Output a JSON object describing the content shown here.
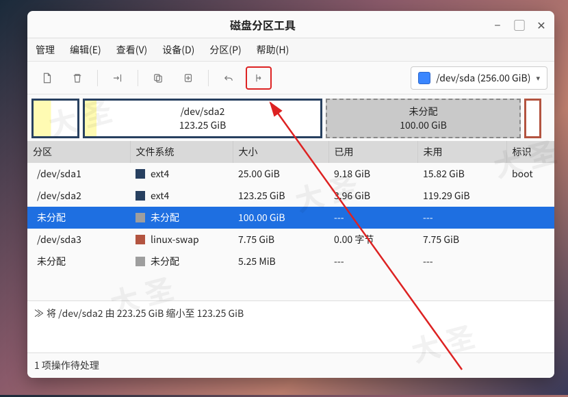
{
  "window": {
    "title": "磁盘分区工具"
  },
  "menu": {
    "manage": "管理",
    "edit": "编辑(E)",
    "view": "查看(V)",
    "device": "设备(D)",
    "partition": "分区(P)",
    "help": "帮助(H)"
  },
  "toolbar": {
    "disk_label": "/dev/sda (256.00 GiB)"
  },
  "partbar": {
    "sda2_name": "/dev/sda2",
    "sda2_size": "123.25 GiB",
    "unalloc_name": "未分配",
    "unalloc_size": "100.00 GiB"
  },
  "columns": {
    "partition": "分区",
    "filesystem": "文件系统",
    "size": "大小",
    "used": "已用",
    "unused": "未用",
    "flags": "标识"
  },
  "rows": [
    {
      "partition": "/dev/sda1",
      "fs": "ext4",
      "fs_class": "fs-ext4",
      "size": "25.00 GiB",
      "used": "9.18 GiB",
      "unused": "15.82 GiB",
      "flags": "boot",
      "selected": false
    },
    {
      "partition": "/dev/sda2",
      "fs": "ext4",
      "fs_class": "fs-ext4",
      "size": "123.25 GiB",
      "used": "3.96 GiB",
      "unused": "119.29 GiB",
      "flags": "",
      "selected": false
    },
    {
      "partition": "未分配",
      "fs": "未分配",
      "fs_class": "fs-unalloc",
      "size": "100.00 GiB",
      "used": "---",
      "unused": "---",
      "flags": "",
      "selected": true
    },
    {
      "partition": "/dev/sda3",
      "fs": "linux-swap",
      "fs_class": "fs-swap",
      "size": "7.75 GiB",
      "used": "0.00 字节",
      "unused": "7.75 GiB",
      "flags": "",
      "selected": false
    },
    {
      "partition": "未分配",
      "fs": "未分配",
      "fs_class": "fs-unalloc",
      "size": "5.25 MiB",
      "used": "---",
      "unused": "---",
      "flags": "",
      "selected": false
    }
  ],
  "log": {
    "entry": "将 /dev/sda2 由 223.25 GiB 缩小至 123.25 GiB"
  },
  "statusbar": {
    "text": "1 项操作待处理"
  },
  "watermark": "大 圣"
}
